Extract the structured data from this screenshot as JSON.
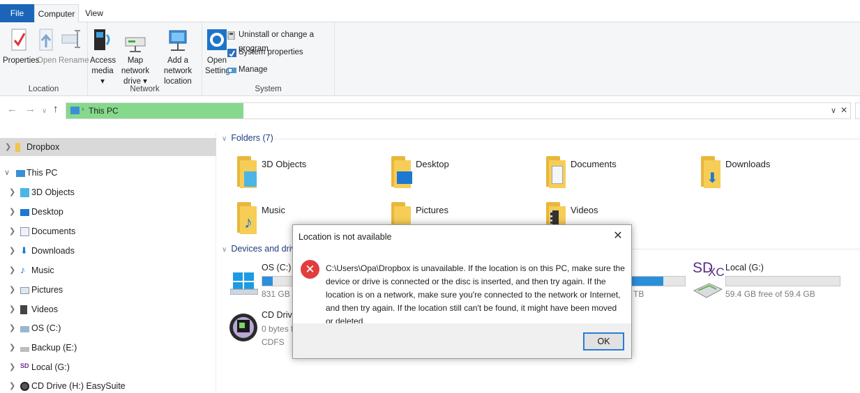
{
  "tabs": {
    "file": "File",
    "computer": "Computer",
    "view": "View"
  },
  "ribbon": {
    "location": {
      "label": "Location",
      "properties": "Properties",
      "open": "Open",
      "rename": "Rename"
    },
    "network": {
      "label": "Network",
      "access_media_1": "Access",
      "access_media_2": "media ▾",
      "map_drive_1": "Map network",
      "map_drive_2": "drive ▾",
      "add_location_1": "Add a network",
      "add_location_2": "location"
    },
    "system": {
      "label": "System",
      "open_settings_1": "Open",
      "open_settings_2": "Settings",
      "uninstall": "Uninstall or change a program",
      "system_properties": "System properties",
      "manage": "Manage"
    }
  },
  "address": {
    "path": "This PC"
  },
  "sidebar": {
    "items": [
      {
        "label": "Dropbox",
        "icon": "folder-icon"
      },
      {
        "label": "This PC",
        "icon": "pc-icon"
      },
      {
        "label": "3D Objects",
        "icon": "cube-icon"
      },
      {
        "label": "Desktop",
        "icon": "desktop-icon"
      },
      {
        "label": "Documents",
        "icon": "document-icon"
      },
      {
        "label": "Downloads",
        "icon": "download-icon"
      },
      {
        "label": "Music",
        "icon": "music-icon"
      },
      {
        "label": "Pictures",
        "icon": "picture-icon"
      },
      {
        "label": "Videos",
        "icon": "video-icon"
      },
      {
        "label": "OS (C:)",
        "icon": "drive-icon"
      },
      {
        "label": "Backup (E:)",
        "icon": "drive-icon"
      },
      {
        "label": "Local (G:)",
        "icon": "sdcard-icon"
      },
      {
        "label": "CD Drive (H:) EasySuite",
        "icon": "cd-icon"
      }
    ]
  },
  "content": {
    "folders_header": "Folders (7)",
    "folders": [
      "3D Objects",
      "Desktop",
      "Documents",
      "Downloads",
      "Music",
      "Pictures",
      "Videos"
    ],
    "devices_header": "Devices and drives",
    "drives": {
      "c": {
        "name": "OS (C:)",
        "free": "831 GB fr",
        "used_fraction": 0.09
      },
      "e_free_tail": "TB",
      "e_used_fraction": 0.62,
      "g": {
        "name": "Local (G:)",
        "free": "59.4 GB free of 59.4 GB",
        "used_fraction": 0.0
      },
      "h": {
        "name": "CD Drive",
        "free": "0 bytes fr",
        "fs": "CDFS"
      }
    }
  },
  "dialog": {
    "title": "Location is not available",
    "message": "C:\\Users\\Opa\\Dropbox is unavailable. If the location is on this PC, make sure the device or drive is connected or the disc is inserted, and then try again. If the location is on a network, make sure you're connected to the network or Internet, and then try again. If the location still can't be found, it might have been moved or deleted.",
    "ok_label": "OK",
    "close_glyph": "✕",
    "error_glyph": "✕"
  },
  "colors": {
    "accent": "#1a65b8",
    "address_highlight": "#86d98c",
    "error": "#e03e3e",
    "drive_bar": "#2b8fd9"
  }
}
